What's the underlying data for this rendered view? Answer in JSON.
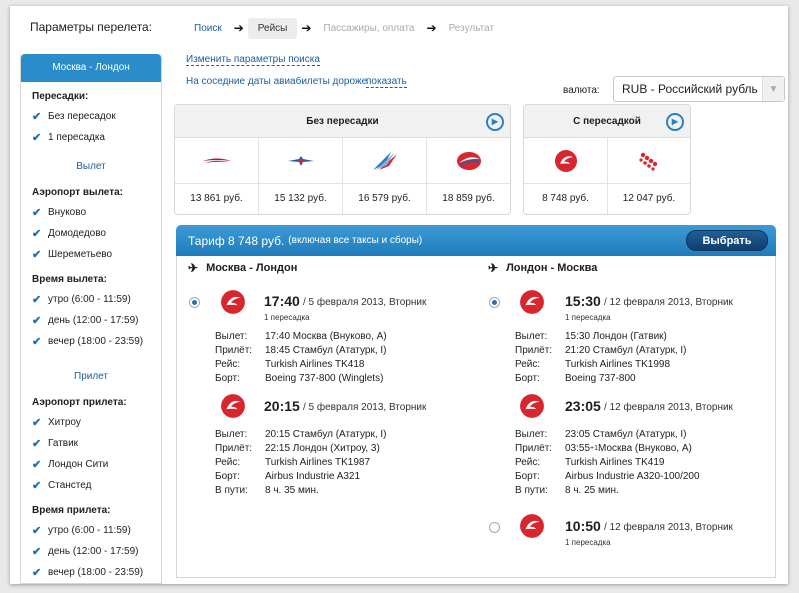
{
  "page_title": "Параметры перелета:",
  "steps": [
    "Поиск",
    "Рейсы",
    "Пассажиры, оплата",
    "Результат"
  ],
  "step_arrow": "➔",
  "sidebar": {
    "route": "Москва - Лондон",
    "transfers_title": "Пересадки:",
    "transfers": [
      "Без пересадок",
      "1 пересадка"
    ],
    "departure_title": "Вылет",
    "dep_airport_title": "Аэропорт вылета:",
    "dep_airports": [
      "Внуково",
      "Домодедово",
      "Шереметьево"
    ],
    "dep_time_title": "Время вылета:",
    "dep_times": [
      "утро (6:00 - 11:59)",
      "день (12:00 - 17:59)",
      "вечер (18:00 - 23:59)"
    ],
    "arrival_title": "Прилет",
    "arr_airport_title": "Аэропорт прилета:",
    "arr_airports": [
      "Хитроу",
      "Гатвик",
      "Лондон Сити",
      "Станстед"
    ],
    "arr_time_title": "Время прилета:",
    "arr_times": [
      "утро (6:00 - 11:59)",
      "день (12:00 - 17:59)",
      "вечер (18:00 - 23:59)"
    ]
  },
  "links": {
    "change_params": "Изменить параметры поиска",
    "nearby_dates": "На соседние даты авиабилеты дороже",
    "show": "показать"
  },
  "currency": {
    "label": "валюта:",
    "value": "RUB - Российский рубль"
  },
  "direct": {
    "title": "Без пересадки",
    "prices": [
      "13 861 руб.",
      "15 132 руб.",
      "16 579 руб.",
      "18 859 руб."
    ]
  },
  "transfer": {
    "title": "С пересадкой",
    "prices": [
      "8 748 руб.",
      "12 047 руб."
    ]
  },
  "tariff": {
    "main": "Тариф 8 748 руб.",
    "sub": "(включая все таксы и сборы)",
    "button": "Выбрать"
  },
  "outbound": {
    "title": "Москва - Лондон",
    "option": {
      "time": "17:40",
      "date": " / 5 февраля 2013, Вторник",
      "stops": "1 пересадка"
    },
    "seg1": {
      "rows": [
        [
          "Вылет:",
          "17:40 Москва (Внуково, А)"
        ],
        [
          "Прилёт:",
          "18:45 Стамбул (Ататурк, I)"
        ],
        [
          "Рейс:",
          "Turkish Airlines TK418"
        ],
        [
          "Борт:",
          "Boeing 737-800 (Winglets)"
        ]
      ]
    },
    "seg2": {
      "time": "20:15",
      "date": " / 5 февраля 2013, Вторник",
      "rows": [
        [
          "Вылет:",
          "20:15 Стамбул (Ататурк, I)"
        ],
        [
          "Прилёт:",
          "22:15 Лондон (Хитроу, 3)"
        ],
        [
          "Рейс:",
          "Turkish Airlines TK1987"
        ],
        [
          "Борт:",
          "Airbus Industrie A321"
        ],
        [
          "В пути:",
          "8 ч. 35 мин."
        ]
      ]
    }
  },
  "return": {
    "title": "Лондон - Москва",
    "option": {
      "time": "15:30",
      "date": " / 12 февраля 2013, Вторник",
      "stops": "1 пересадка"
    },
    "seg1": {
      "rows": [
        [
          "Вылет:",
          "15:30 Лондон (Гатвик)"
        ],
        [
          "Прилёт:",
          "21:20 Стамбул (Ататурк, I)"
        ],
        [
          "Рейс:",
          "Turkish Airlines TK1998"
        ],
        [
          "Борт:",
          "Boeing 737-800"
        ]
      ]
    },
    "seg2": {
      "time": "23:05",
      "date": " / 12 февраля 2013, Вторник",
      "rows": [
        [
          "Вылет:",
          "23:05 Стамбул (Ататурк, I)"
        ],
        [
          "Прилёт:",
          "03:55"
        ],
        [
          "Рейс:",
          "Turkish Airlines TK419"
        ],
        [
          "Борт:",
          "Airbus Industrie A320-100/200"
        ],
        [
          "В пути:",
          "8 ч. 25 мин."
        ]
      ],
      "arrival_plus": "+1",
      "arrival_rest": " Москва (Внуково, А)"
    },
    "option2": {
      "time": "10:50",
      "date": " / 12 февраля 2013, Вторник",
      "stops": "1 пересадка"
    }
  },
  "colors": {
    "accent": "#2a8cc8",
    "link": "#1b5e9e",
    "turkish_red": "#d8262e"
  }
}
